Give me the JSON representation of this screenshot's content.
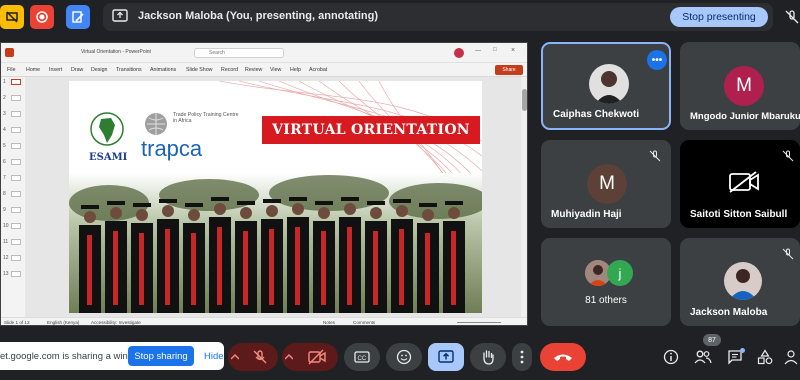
{
  "topbar": {
    "presenting_text": "Jackson Maloba (You, presenting, annotating)",
    "stop_presenting_label": "Stop presenting"
  },
  "presentation": {
    "window_title": "Virtual Orientation - PowerPoint",
    "search_placeholder": "Search",
    "menu": [
      "File",
      "Home",
      "Insert",
      "Draw",
      "Design",
      "Transitions",
      "Animations",
      "Slide Show",
      "Record",
      "Review",
      "View",
      "Help",
      "Acrobat"
    ],
    "share_label": "Share",
    "thumb_numbers": [
      "1",
      "2",
      "3",
      "4",
      "5",
      "6",
      "7",
      "8",
      "9",
      "10",
      "11",
      "12",
      "13"
    ],
    "status": {
      "slide_of": "Slide 1 of 13",
      "language": "English (Kenya)",
      "accessibility": "Accessibility: Investigate",
      "notes": "Notes",
      "comments": "Comments"
    },
    "slide": {
      "title_banner": "VIRTUAL ORIENTATION",
      "org1": "ESAMI",
      "org2": "trapca",
      "org2_subtitle": "Trade Policy Training Centre in Africa"
    }
  },
  "participants": [
    {
      "name": "Caiphas Chekwoti",
      "active": true
    },
    {
      "name": "Mngodo Junior Mbaruku",
      "initial": "M",
      "color": "#b0204f"
    },
    {
      "name": "Muhiyadin Haji",
      "initial": "M",
      "color": "#5d4037"
    },
    {
      "name": "Saitoti Sitton Saibull"
    },
    {
      "name": "81 others",
      "initial": "j",
      "color": "#33a852"
    },
    {
      "name": "Jackson Maloba"
    }
  ],
  "bottombar": {
    "share_text": "et.google.com is sharing a window.",
    "stop_sharing_label": "Stop sharing",
    "hide_label": "Hide",
    "participant_count": "87"
  },
  "colors": {
    "meet_bg": "#202124",
    "tile_bg": "#3c4043",
    "end_call": "#ea4335",
    "accent_blue": "#8ab4f8",
    "slide_red": "#d71920"
  }
}
